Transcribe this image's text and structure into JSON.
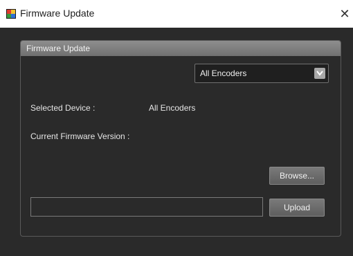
{
  "window": {
    "title": "Firmware Update",
    "close_glyph": "✕"
  },
  "panel": {
    "header": "Firmware Update",
    "device_select": {
      "selected": "All Encoders"
    },
    "selected_device_label": "Selected Device :",
    "selected_device_value": "All Encoders",
    "current_firmware_label": "Current Firmware Version :",
    "current_firmware_value": "",
    "browse_label": "Browse...",
    "file_path_value": "",
    "upload_label": "Upload"
  },
  "icons": {
    "app": "app-logo-icon",
    "close": "close-icon",
    "dropdown": "chevron-down-icon"
  },
  "colors": {
    "background": "#2b2b2b",
    "panel_header": "#7f7f7f",
    "button": "#6b6b6b",
    "text": "#e6e6e6"
  }
}
